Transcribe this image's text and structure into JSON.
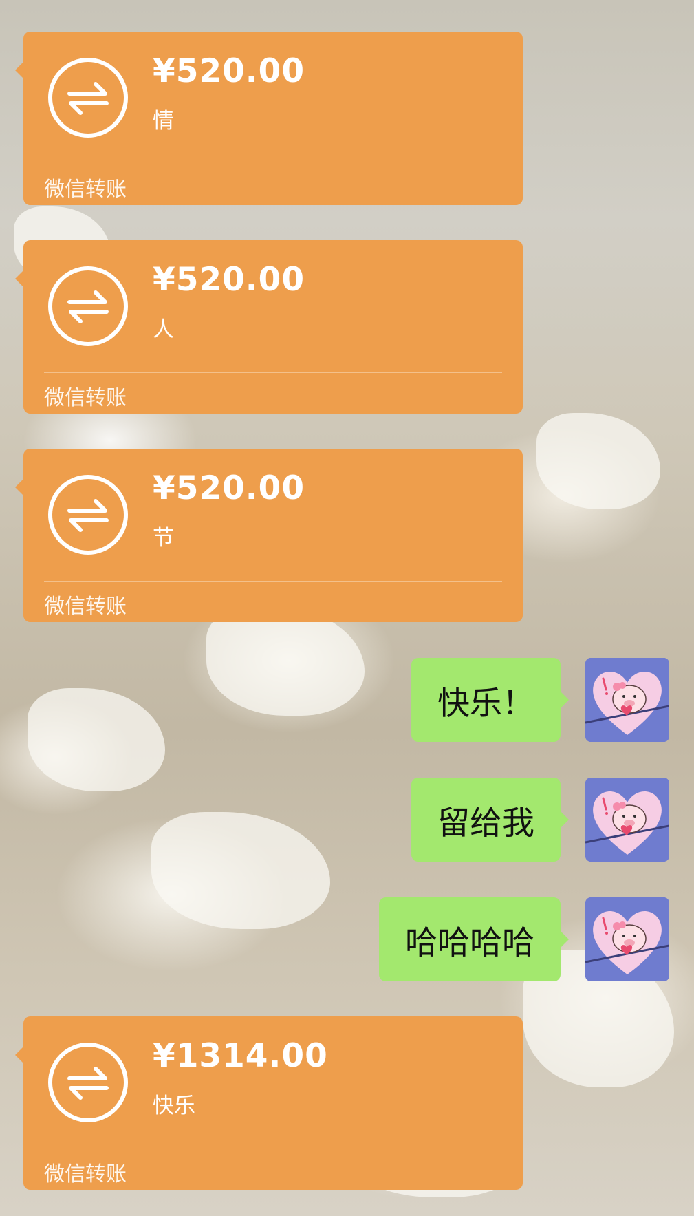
{
  "transfers": [
    {
      "amount": "¥520.00",
      "note": "情",
      "footer": "微信转账"
    },
    {
      "amount": "¥520.00",
      "note": "人",
      "footer": "微信转账"
    },
    {
      "amount": "¥520.00",
      "note": "节",
      "footer": "微信转账"
    },
    {
      "amount": "¥1314.00",
      "note": "快乐",
      "footer": "微信转账"
    }
  ],
  "messages": [
    {
      "text": "快乐！",
      "avatar_icon": "pig-sticker-avatar"
    },
    {
      "text": "留给我",
      "avatar_icon": "pig-sticker-avatar"
    },
    {
      "text": "哈哈哈哈",
      "avatar_icon": "pig-sticker-avatar"
    }
  ],
  "colors": {
    "transfer_bubble": "#ee9e4c",
    "sent_bubble": "#a3e86e",
    "avatar_bg": "#6f7ccf"
  },
  "icons": {
    "transfer": "transfer-arrows-icon"
  }
}
